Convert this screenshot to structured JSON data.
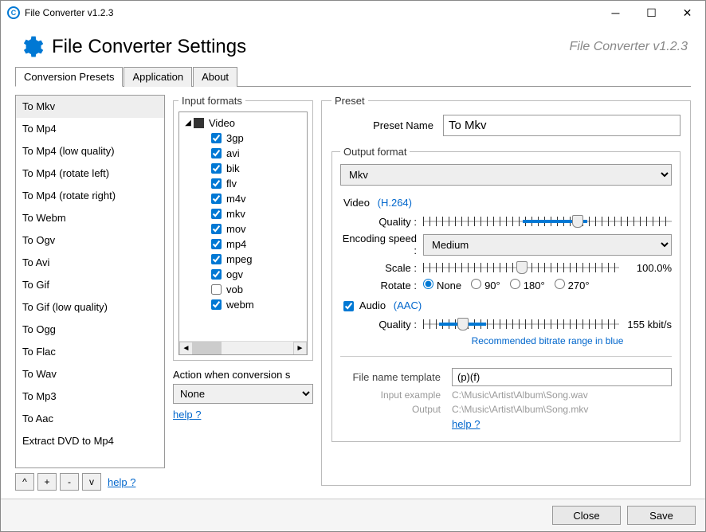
{
  "window": {
    "title": "File Converter v1.2.3"
  },
  "header": {
    "title": "File Converter Settings",
    "subtitle": "File Converter v1.2.3"
  },
  "tabs": [
    {
      "label": "Conversion Presets",
      "active": true
    },
    {
      "label": "Application",
      "active": false
    },
    {
      "label": "About",
      "active": false
    }
  ],
  "presets": {
    "selected": 0,
    "items": [
      "To Mkv",
      "To Mp4",
      "To Mp4 (low quality)",
      "To Mp4 (rotate left)",
      "To Mp4 (rotate right)",
      "To Webm",
      "To Ogv",
      "To Avi",
      "To Gif",
      "To Gif (low quality)",
      "To Ogg",
      "To Flac",
      "To Wav",
      "To Mp3",
      "To Aac",
      "Extract DVD to Mp4"
    ],
    "buttons": {
      "up": "^",
      "add": "+",
      "remove": "-",
      "down": "v"
    },
    "help": "help ?"
  },
  "input_formats": {
    "legend": "Input formats",
    "group": "Video",
    "items": [
      {
        "name": "3gp",
        "checked": true
      },
      {
        "name": "avi",
        "checked": true
      },
      {
        "name": "bik",
        "checked": true
      },
      {
        "name": "flv",
        "checked": true
      },
      {
        "name": "m4v",
        "checked": true
      },
      {
        "name": "mkv",
        "checked": true
      },
      {
        "name": "mov",
        "checked": true
      },
      {
        "name": "mp4",
        "checked": true
      },
      {
        "name": "mpeg",
        "checked": true
      },
      {
        "name": "ogv",
        "checked": true
      },
      {
        "name": "vob",
        "checked": false
      },
      {
        "name": "webm",
        "checked": true
      }
    ]
  },
  "action_label": "Action when conversion s",
  "action_value": "None",
  "action_help": "help ?",
  "preset": {
    "legend": "Preset",
    "name_label": "Preset Name",
    "name_value": "To Mkv",
    "output": {
      "legend": "Output format",
      "format": "Mkv",
      "video": {
        "label": "Video",
        "codec": "(H.264)",
        "quality_label": "Quality :",
        "enc_label": "Encoding speed :",
        "enc_value": "Medium",
        "scale_label": "Scale :",
        "scale_value": "100.0%",
        "rotate_label": "Rotate :",
        "rotate_options": [
          "None",
          "90°",
          "180°",
          "270°"
        ],
        "rotate_selected": "None"
      },
      "audio": {
        "label": "Audio",
        "codec": "(AAC)",
        "enabled": true,
        "quality_label": "Quality :",
        "bitrate": "155 kbit/s",
        "reco": "Recommended bitrate range in blue"
      },
      "filename": {
        "label": "File name template",
        "value": "(p)(f)",
        "input_example_label": "Input example",
        "input_example": "C:\\Music\\Artist\\Album\\Song.wav",
        "output_label": "Output",
        "output_example": "C:\\Music\\Artist\\Album\\Song.mkv",
        "help": "help ?"
      }
    }
  },
  "footer": {
    "close": "Close",
    "save": "Save"
  }
}
